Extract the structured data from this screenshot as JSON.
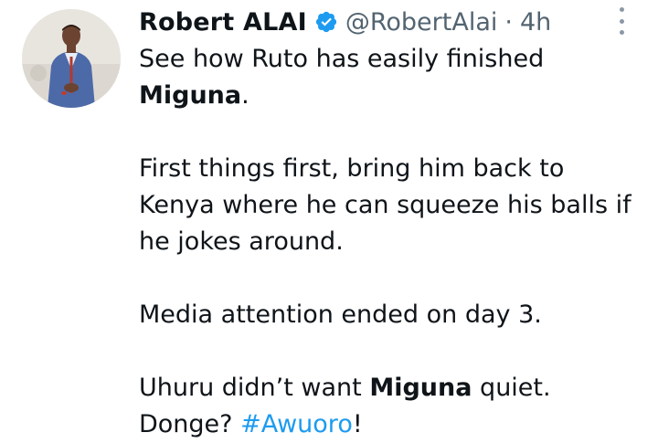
{
  "tweet": {
    "author": {
      "display_name": "Robert ALAI",
      "handle": "@RobertAlai",
      "verified_icon": "verified-badge-icon",
      "verified_color": "#1d9bf0"
    },
    "separator": "·",
    "time": "4h",
    "more_icon": "more-options-icon",
    "body": {
      "p1_a": "See how Ruto has easily finished",
      "p1_bold": "Miguna",
      "p1_end": ".",
      "p2_l1": "First things first, bring him back to",
      "p2_l2": "Kenya where he can squeeze his balls if",
      "p2_l3": "he jokes around.",
      "p3": "Media attention ended on day 3.",
      "p4_a": "Uhuru didn’t want ",
      "p4_bold": "Miguna",
      "p4_end": " quiet.",
      "p5_a": "Donge? ",
      "p5_hashtag": "#Awuoro",
      "p5_end": "!"
    }
  },
  "colors": {
    "text": "#0f1419",
    "secondary": "#536471",
    "link": "#1d9bf0"
  }
}
